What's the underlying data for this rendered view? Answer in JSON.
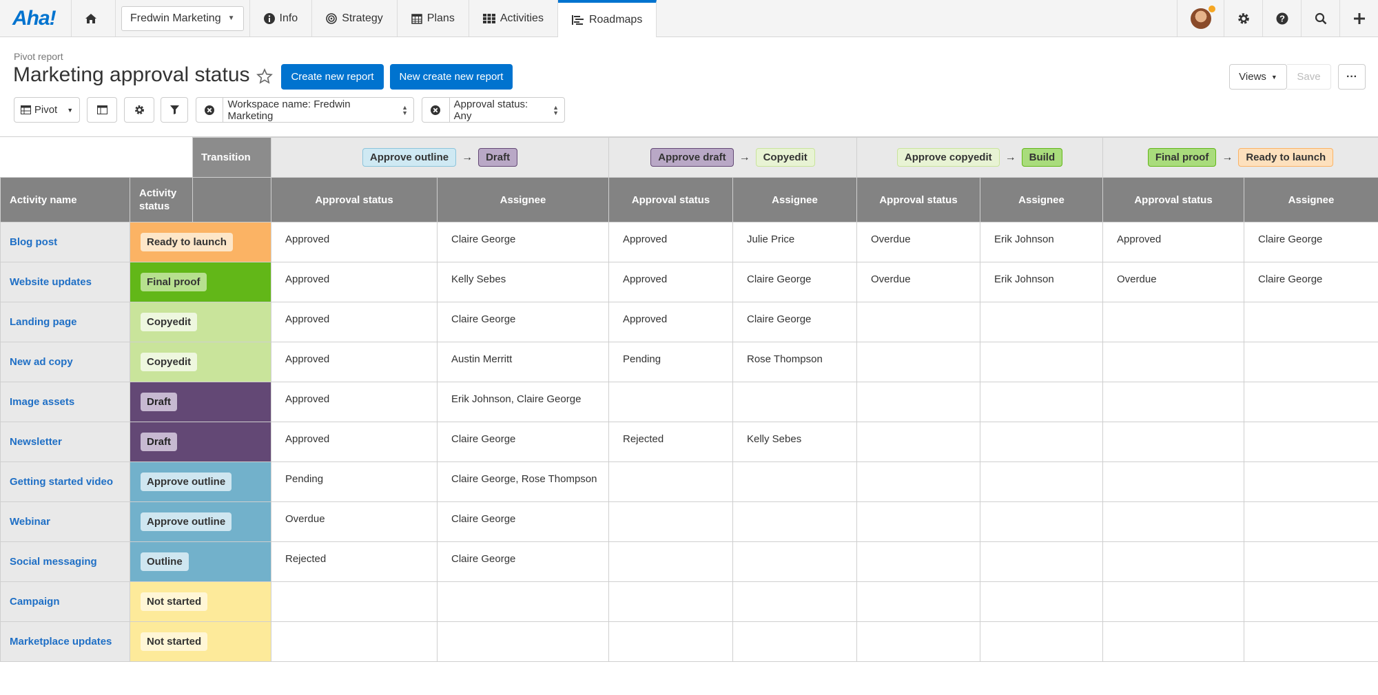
{
  "app": {
    "logo": "Aha!"
  },
  "nav": {
    "workspace": "Fredwin Marketing",
    "items": [
      {
        "label": "Info",
        "icon": "info-icon"
      },
      {
        "label": "Strategy",
        "icon": "target-icon"
      },
      {
        "label": "Plans",
        "icon": "calendar-icon"
      },
      {
        "label": "Activities",
        "icon": "grid-icon"
      },
      {
        "label": "Roadmaps",
        "icon": "roadmap-icon",
        "active": true
      }
    ]
  },
  "header": {
    "breadcrumb": "Pivot report",
    "title": "Marketing approval status",
    "create_button": "Create new report",
    "new_create_button": "New create new report",
    "views_button": "Views",
    "save_button": "Save"
  },
  "toolbar": {
    "pivot_label": "Pivot",
    "filter_workspace": "Workspace name: Fredwin Marketing",
    "filter_approval": "Approval status: Any"
  },
  "colors": {
    "accent": "#0073cf",
    "ready_to_launch": "#fbb364",
    "final_proof": "#62b718",
    "copyedit": "#c9e49b",
    "draft": "#634875",
    "approve_outline": "#72b1cb",
    "outline": "#72b1cb",
    "not_started": "#fdea9a"
  },
  "table": {
    "transition_label": "Transition",
    "transitions": [
      {
        "from": "Approve outline",
        "to": "Draft"
      },
      {
        "from": "Approve draft",
        "to": "Copyedit"
      },
      {
        "from": "Approve copyedit",
        "to": "Build"
      },
      {
        "from": "Final proof",
        "to": "Ready to launch"
      }
    ],
    "headers": {
      "activity_name": "Activity name",
      "activity_status": "Activity status",
      "approval_status": "Approval status",
      "assignee": "Assignee"
    },
    "rows": [
      {
        "name": "Blog post",
        "status": "Ready to launch",
        "cells": [
          "Approved",
          "Claire George",
          "Approved",
          "Julie Price",
          "Overdue",
          "Erik Johnson",
          "Approved",
          "Claire George"
        ]
      },
      {
        "name": "Website updates",
        "status": "Final proof",
        "cells": [
          "Approved",
          "Kelly Sebes",
          "Approved",
          "Claire George",
          "Overdue",
          "Erik Johnson",
          "Overdue",
          "Claire George"
        ]
      },
      {
        "name": "Landing page",
        "status": "Copyedit",
        "cells": [
          "Approved",
          "Claire George",
          "Approved",
          "Claire George",
          "",
          "",
          "",
          ""
        ]
      },
      {
        "name": "New ad copy",
        "status": "Copyedit",
        "cells": [
          "Approved",
          "Austin Merritt",
          "Pending",
          "Rose Thompson",
          "",
          "",
          "",
          ""
        ]
      },
      {
        "name": "Image assets",
        "status": "Draft",
        "cells": [
          "Approved",
          "Erik Johnson, Claire George",
          "",
          "",
          "",
          "",
          "",
          ""
        ]
      },
      {
        "name": "Newsletter",
        "status": "Draft",
        "cells": [
          "Approved",
          "Claire George",
          "Rejected",
          "Kelly Sebes",
          "",
          "",
          "",
          ""
        ]
      },
      {
        "name": "Getting started video",
        "status": "Approve outline",
        "cells": [
          "Pending",
          "Claire George, Rose Thompson",
          "",
          "",
          "",
          "",
          "",
          ""
        ]
      },
      {
        "name": "Webinar",
        "status": "Approve outline",
        "cells": [
          "Overdue",
          "Claire George",
          "",
          "",
          "",
          "",
          "",
          ""
        ]
      },
      {
        "name": "Social messaging",
        "status": "Outline",
        "cells": [
          "Rejected",
          "Claire George",
          "",
          "",
          "",
          "",
          "",
          ""
        ]
      },
      {
        "name": "Campaign",
        "status": "Not started",
        "cells": [
          "",
          "",
          "",
          "",
          "",
          "",
          "",
          ""
        ]
      },
      {
        "name": "Marketplace updates",
        "status": "Not started",
        "cells": [
          "",
          "",
          "",
          "",
          "",
          "",
          "",
          ""
        ]
      }
    ]
  }
}
